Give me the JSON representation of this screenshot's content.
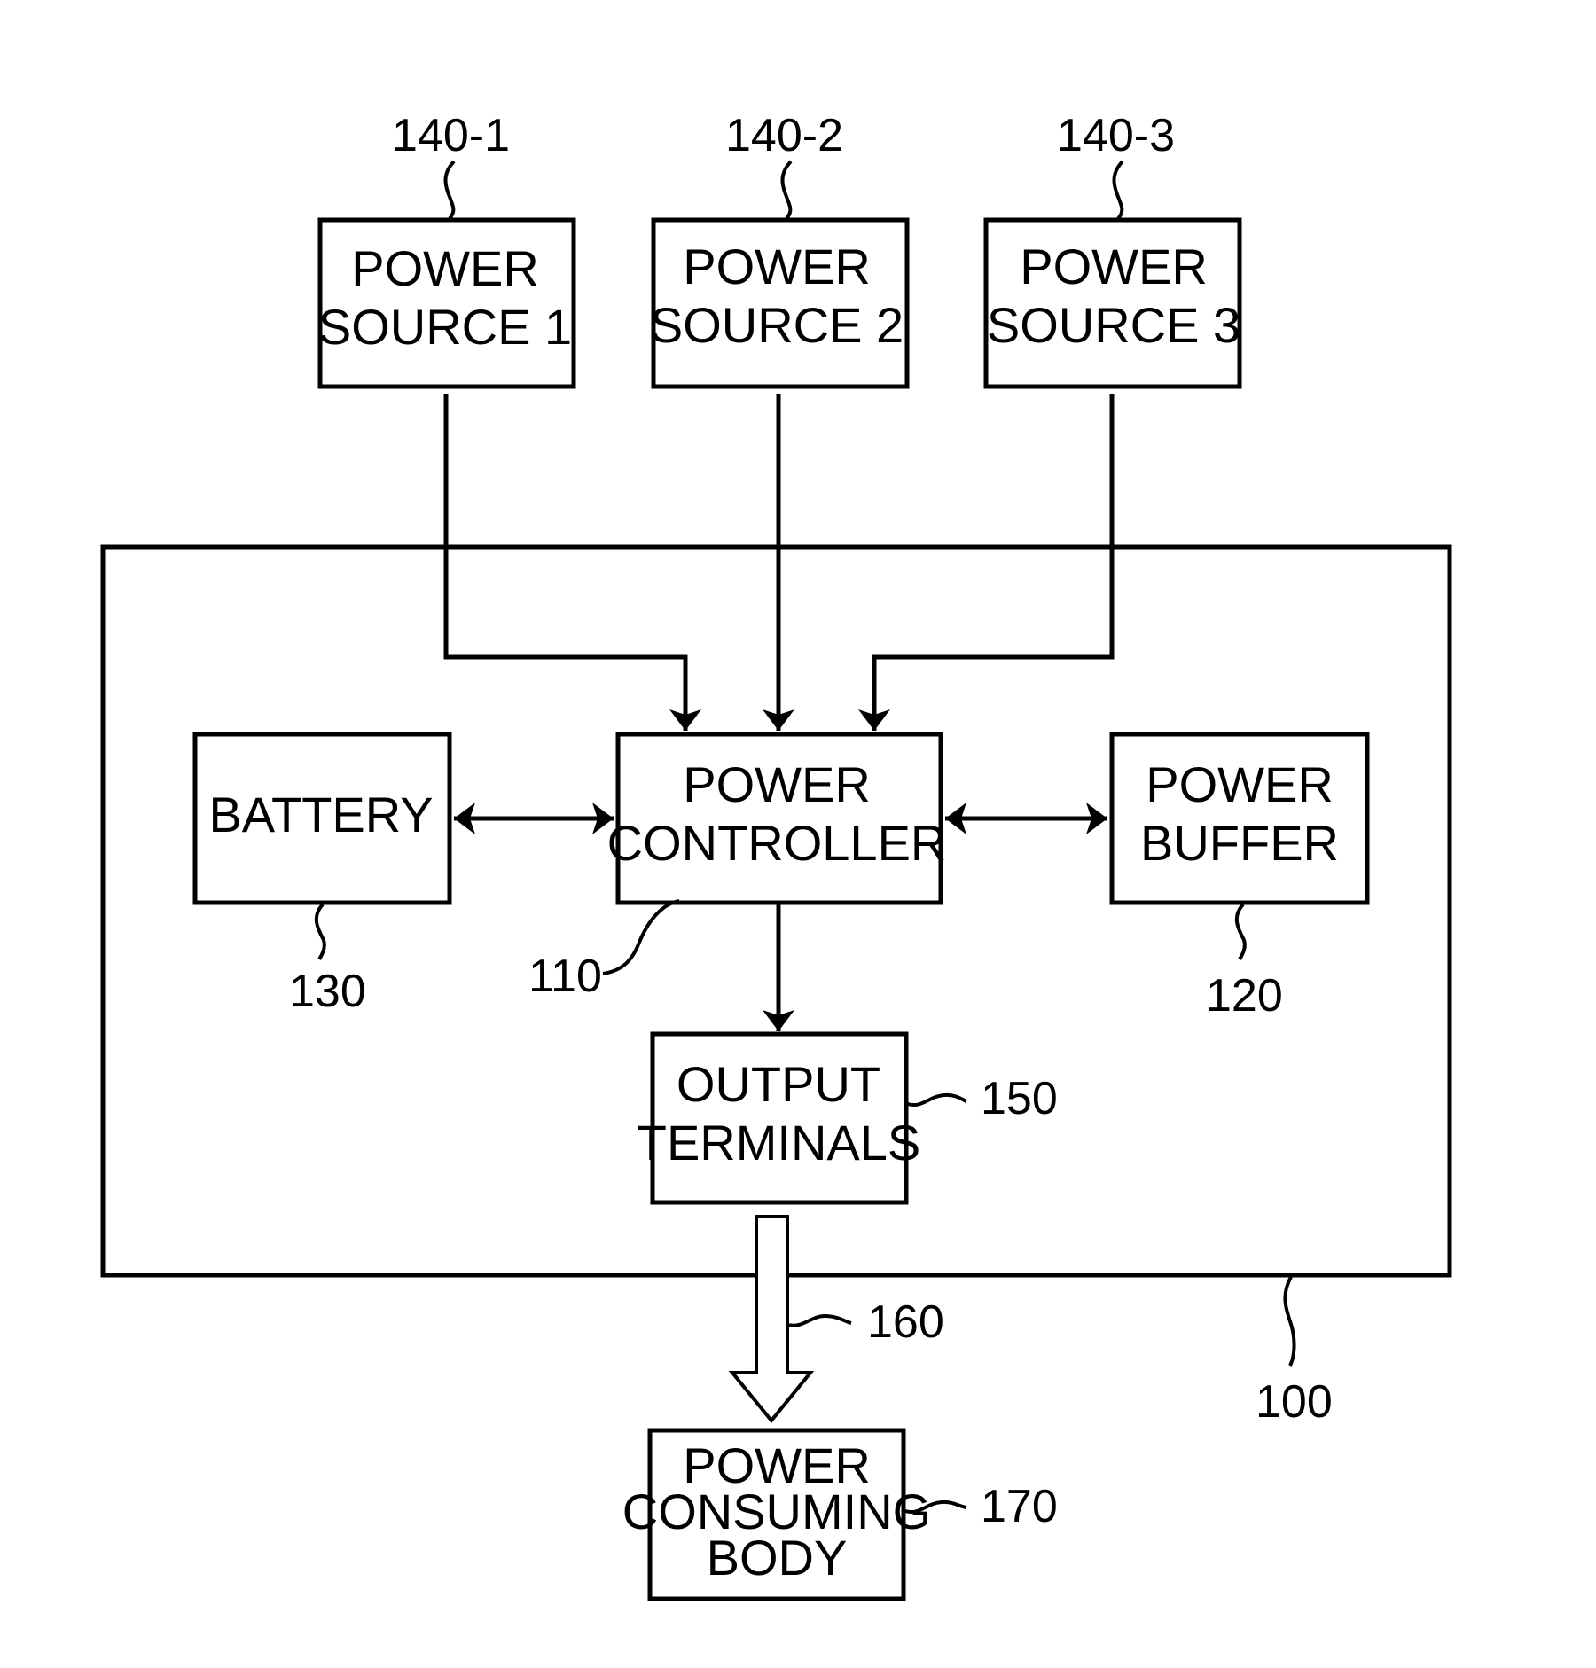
{
  "figure": {
    "power_sources": [
      {
        "ref": "140-1",
        "line1": "POWER",
        "line2": "SOURCE  1"
      },
      {
        "ref": "140-2",
        "line1": "POWER",
        "line2": "SOURCE  2"
      },
      {
        "ref": "140-3",
        "line1": "POWER",
        "line2": "SOURCE  3"
      }
    ],
    "battery": {
      "label": "BATTERY",
      "ref": "130"
    },
    "controller": {
      "line1": "POWER",
      "line2": "CONTROLLER",
      "ref": "110"
    },
    "buffer": {
      "line1": "POWER",
      "line2": "BUFFER",
      "ref": "120"
    },
    "output": {
      "line1": "OUTPUT",
      "line2": "TERMINALS",
      "ref": "150"
    },
    "transfer": {
      "ref": "160"
    },
    "consumer": {
      "line1": "POWER",
      "line2": "CONSUMING",
      "line3": "BODY",
      "ref": "170"
    },
    "device": {
      "ref": "100"
    }
  }
}
